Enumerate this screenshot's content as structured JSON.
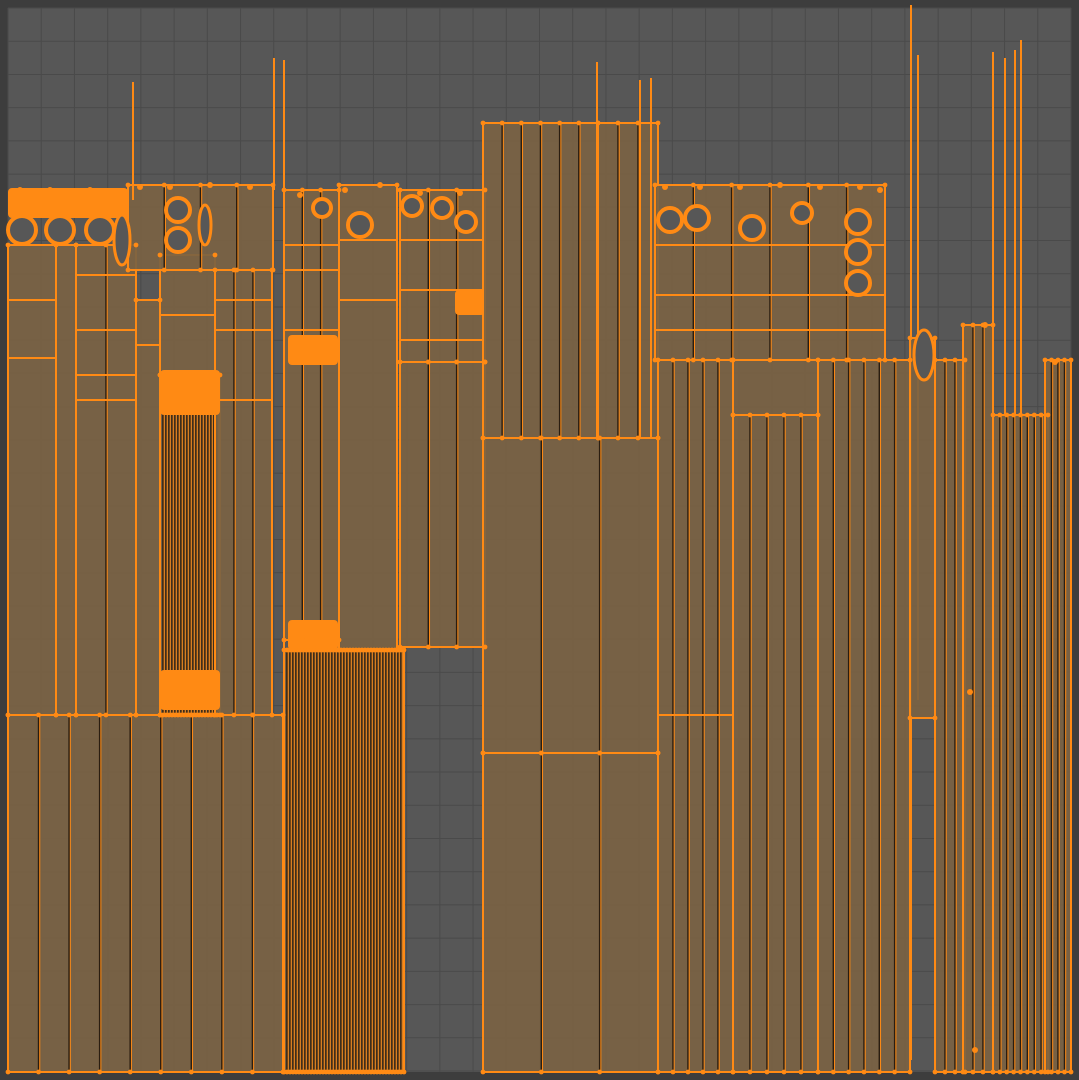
{
  "editor": {
    "type": "uv-editor",
    "mode": "edit",
    "select_mode": "vertex"
  },
  "colors": {
    "frame_background": "#3d3d3d",
    "uv_space_background": "#575757",
    "grid_line": "#4a4a4a",
    "grid_line_major": "#444444",
    "face_fill": "#7a6243",
    "edge_selected": "#ff8a14",
    "edge_dark": "#2a1d10",
    "vertex_selected": "#ff8a14"
  },
  "icons": {
    "vertex": "vertex-dot-icon"
  }
}
